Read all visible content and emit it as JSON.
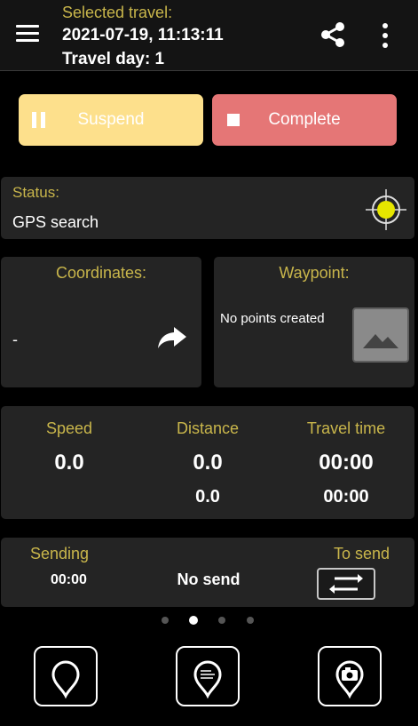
{
  "header": {
    "selected_label": "Selected travel:",
    "datetime": "2021-07-19, 11:13:11",
    "travel_day": "Travel day: 1"
  },
  "actions": {
    "suspend_label": "Suspend",
    "complete_label": "Complete"
  },
  "status": {
    "label": "Status:",
    "value": "GPS search"
  },
  "coordinates": {
    "label": "Coordinates:",
    "value": "-"
  },
  "waypoint": {
    "label": "Waypoint:",
    "value": "No points created"
  },
  "stats": {
    "speed": {
      "label": "Speed",
      "value": "0.0"
    },
    "distance": {
      "label": "Distance",
      "value": "0.0",
      "sub_value": "0.0"
    },
    "travel_time": {
      "label": "Travel time",
      "value": "00:00",
      "sub_value": "00:00"
    }
  },
  "sending": {
    "label": "Sending",
    "time": "00:00",
    "status": "No send",
    "to_send_label": "To send"
  },
  "pager": {
    "total_pages": 4,
    "active_page": 2
  },
  "icons": {
    "menu": "hamburger-menu-icon",
    "share": "share-icon",
    "more": "more-vertical-icon",
    "gps": "gps-crosshair-icon",
    "forward": "forward-arrow-icon",
    "image": "image-placeholder-icon",
    "swap": "swap-arrows-icon",
    "nav": [
      "add-waypoint-icon",
      "add-note-icon",
      "add-photo-icon"
    ]
  },
  "colors": {
    "accent_label": "#c9b64b",
    "suspend": "#fde08c",
    "complete": "#e57676",
    "card": "#242424",
    "gps_dot": "#e6e600"
  }
}
